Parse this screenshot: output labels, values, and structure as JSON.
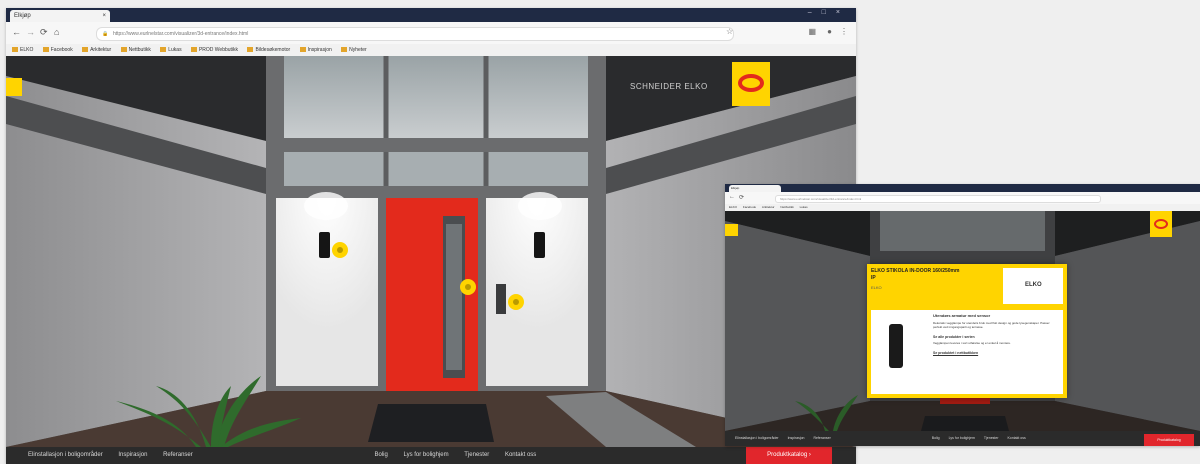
{
  "main": {
    "tab_title": "Elkjøp",
    "url": "https://www.eurlnelstar.com/visualizer/3d-entrance/index.html",
    "bookmarks": [
      "ELKO",
      "Facebook",
      "Arkitektur",
      "Nettbutikk",
      "Lukas",
      "PROD Webbutikk",
      "Bildesøkemotor",
      "Inspirasjon",
      "Nyheter"
    ],
    "logo_text": "SCHNEIDER ELKO",
    "footer_left": [
      "Elinstallasjon i boligområder",
      "Inspirasjon",
      "Referanser"
    ],
    "footer_right": [
      "Bolig",
      "Lys for bolighjem",
      "Tjenester",
      "Kontakt oss"
    ],
    "cta": "Produktkatalog",
    "cta_arrow": "›"
  },
  "popup": {
    "title": "ELKO STIKOLA IN-DOOR 160/250mm IP",
    "subtitle": "ELKO",
    "brand": "ELKO",
    "heading": "Utendørs armatur med sensor",
    "body": "Dekorativ vegglampe for utendørs bruk med flott design og gode lysegenskaper. Passer perfekt ved inngangsparti og terrasse.",
    "subheading": "Se alle produkter i serien",
    "body2": "Vegglampen leveres i sort utførelse og er enkel å montere.",
    "link": "Se produktet i nettbutikken"
  },
  "colors": {
    "accent_yellow": "#ffd400",
    "door_red": "#e32a1c",
    "cta_red": "#e1262c",
    "chrome_dark": "#1f2a44"
  }
}
